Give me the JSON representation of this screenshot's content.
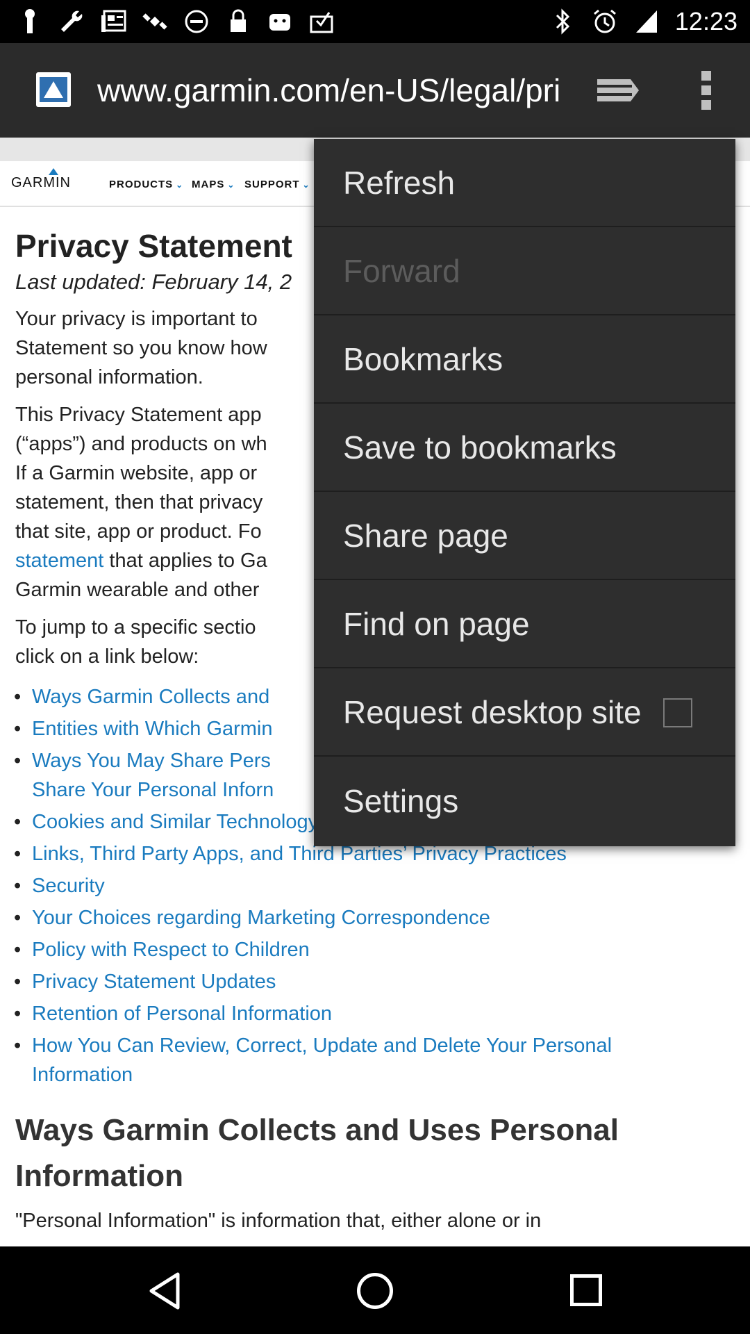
{
  "status_bar": {
    "time": "12:23",
    "left_icons": [
      "notification-icon",
      "wrench-icon",
      "news-icon",
      "satellite-icon",
      "dnd-icon",
      "lock-icon",
      "android-icon",
      "inbox-icon"
    ],
    "right_icons": [
      "bluetooth-icon",
      "alarm-icon",
      "signal-icon"
    ]
  },
  "url_bar": {
    "url": "www.garmin.com/en-US/legal/privacy-statement"
  },
  "site_nav": {
    "logo": "GARMIN",
    "items": [
      "PRODUCTS",
      "MAPS",
      "SUPPORT"
    ]
  },
  "content": {
    "title": "Privacy Statement",
    "updated": "Last updated: February 14, 2",
    "para1": "Your privacy is important to",
    "para1_l2": "Statement so you know how",
    "para1_l3": "personal information.",
    "para2_l1": "This Privacy Statement app",
    "para2_l2": "(“apps”) and products on wh",
    "para2_l3": "If a Garmin website, app or",
    "para2_l4": "statement, then that privacy",
    "para2_l5": "that site, app or product. Fo",
    "para2_l6_link": "statement",
    "para2_l6_rest": " that applies to Ga",
    "para2_l7": "Garmin wearable and other",
    "para3_l1": "To jump to a specific sectio",
    "para3_l2": "click on a link below:",
    "links": [
      "Ways Garmin Collects and",
      "Entities with Which Garmin",
      "Ways You May Share Pers",
      "Share Your Personal Inforn",
      "Cookies and Similar Technology",
      "Links, Third Party Apps, and Third Parties’ Privacy Practices",
      "Security",
      "Your Choices regarding Marketing Correspondence",
      "Policy with Respect to Children",
      "Privacy Statement Updates",
      "Retention of Personal Information",
      "How You Can Review, Correct, Update and Delete Your Personal",
      "Information"
    ],
    "section_title_l1": "Ways Garmin Collects and Uses Personal",
    "section_title_l2": "Information",
    "section_para": "\"Personal Information\" is information that, either alone or in"
  },
  "menu": {
    "items": [
      {
        "label": "Refresh",
        "enabled": true
      },
      {
        "label": "Forward",
        "enabled": false
      },
      {
        "label": "Bookmarks",
        "enabled": true
      },
      {
        "label": "Save to bookmarks",
        "enabled": true
      },
      {
        "label": "Share page",
        "enabled": true
      },
      {
        "label": "Find on page",
        "enabled": true
      },
      {
        "label": "Request desktop site",
        "enabled": true,
        "checkbox": false
      },
      {
        "label": "Settings",
        "enabled": true
      }
    ]
  },
  "colors": {
    "link": "#1a7bbf",
    "menu_bg": "#2e2e2e",
    "urlbar_bg": "#2b2b2b"
  }
}
